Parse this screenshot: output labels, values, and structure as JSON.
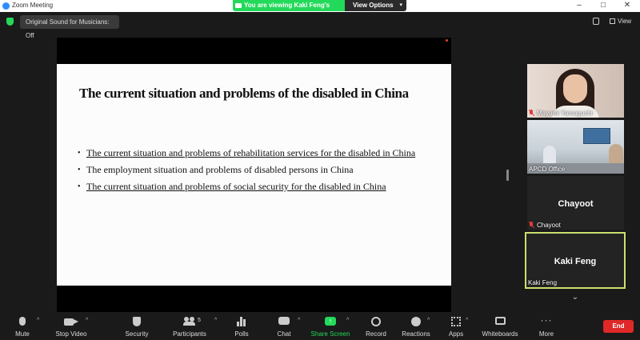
{
  "window": {
    "title": "Zoom Meeting",
    "controls": {
      "minimize": "–",
      "maximize": "□",
      "close": "✕"
    }
  },
  "banner": {
    "viewing_text": "You are viewing Kaki Feng's screen",
    "view_options_label": "View Options",
    "caret": "▾"
  },
  "topbar": {
    "original_sound_label": "Original Sound for Musicians: Off",
    "view_label": "View"
  },
  "slide": {
    "title": "The current situation and problems of  the disabled in China",
    "bullets": [
      "The current situation and problems of rehabilitation services for the disabled in China",
      "The employment situation and problems of disabled persons in China",
      "The current situation and problems of social security for the disabled in China"
    ]
  },
  "gallery": {
    "participants": [
      {
        "name": "Mayumi Yamaguchi",
        "muted": true
      },
      {
        "name": "APCD Office",
        "muted": false
      },
      {
        "name": "Chayoot",
        "display_name": "Chayoot",
        "muted": true
      },
      {
        "name": "Kaki Feng",
        "display_name": "Kaki Feng",
        "muted": false,
        "active_speaker": true
      }
    ],
    "next_arrow": "⌄"
  },
  "toolbar": {
    "caret": "^",
    "mute_label": "Mute",
    "video_label": "Stop Video",
    "security_label": "Security",
    "participants_label": "Participants",
    "participants_count": "5",
    "polls_label": "Polls",
    "chat_label": "Chat",
    "share_label": "Share Screen",
    "share_icon": "↑",
    "record_label": "Record",
    "reactions_label": "Reactions",
    "apps_label": "Apps",
    "whiteboards_label": "Whiteboards",
    "more_label": "More",
    "more_icon": "···",
    "end_label": "End"
  },
  "colors": {
    "accent_green": "#23d959",
    "end_red": "#e02828",
    "active_speaker_border": "#c9e06b",
    "muted_mic_red": "#e23b3b"
  }
}
